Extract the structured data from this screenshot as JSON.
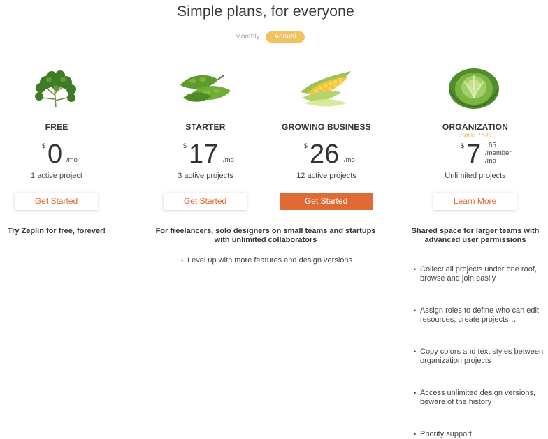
{
  "header": {
    "title": "Simple plans, for everyone",
    "toggle": {
      "monthly": "Monthly",
      "annual": "Annual",
      "selected": "Annual"
    }
  },
  "colors": {
    "accent": "#e06a33",
    "toggle_active": "#f3c25c",
    "save": "#f0b44a"
  },
  "plans": [
    {
      "name": "FREE",
      "icon": "parsley-icon",
      "currency": "$",
      "amount": "0",
      "per": "/mo",
      "projects": "1 active project",
      "cta": "Get Started",
      "description": "Try Zeplin for free, forever!"
    },
    {
      "name": "STARTER",
      "icon": "pea-pods-icon",
      "currency": "$",
      "amount": "17",
      "per": "/mo",
      "projects": "3 active projects",
      "cta": "Get Started"
    },
    {
      "name": "GROWING BUSINESS",
      "icon": "corn-icon",
      "currency": "$",
      "amount": "26",
      "per": "/mo",
      "projects": "12 active projects",
      "cta": "Get Started"
    },
    {
      "name": "ORGANIZATION",
      "icon": "cabbage-icon",
      "save": "Save 15%",
      "currency": "$",
      "amount": "7",
      "cents": ".65",
      "per_member": "/member",
      "per": "/mo",
      "projects": "Unlimited projects",
      "cta": "Learn More",
      "description": "Shared space for larger teams with advanced user permissions",
      "features": [
        "Collect all projects under one roof, browse and join easily",
        "Assign roles to define who can edit resources, create projects…",
        "Copy colors and text styles between organization projects",
        "Access unlimited design versions, beware of the history",
        "Priority support"
      ]
    }
  ],
  "shared": {
    "description": "For freelancers, solo designers on small teams and startups with unlimited collaborators",
    "feature": "Level up with more features and design versions"
  }
}
